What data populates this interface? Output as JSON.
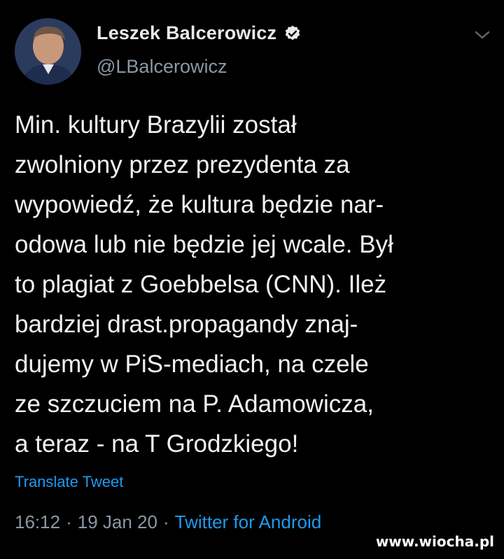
{
  "author": {
    "display_name": "Leszek Balcerowicz",
    "handle": "@LBalcerowicz",
    "verified_icon": "verified-badge-icon"
  },
  "tweet": {
    "lines": [
      "Min. kultury Brazylii został",
      "zwolniony przez prezydenta za",
      "wypowiedź, że kultura będzie nar-",
      "odowa lub nie będzie jej wcale. Był",
      "to plagiat z Goebbelsa (CNN). Ileż",
      "bardziej drast.propagandy znaj-",
      "dujemy w PiS-mediach, na czele",
      "ze szczuciem na P. Adamowicza,",
      "a teraz - na T Grodzkiego!"
    ],
    "translate_label": "Translate Tweet",
    "time": "16:12",
    "date": "19 Jan 20",
    "source": "Twitter for Android",
    "separator": "·"
  },
  "watermark": "www.wiocha.pl",
  "colors": {
    "background": "#000000",
    "link": "#1d9bf0",
    "secondary": "#8b98a5"
  }
}
